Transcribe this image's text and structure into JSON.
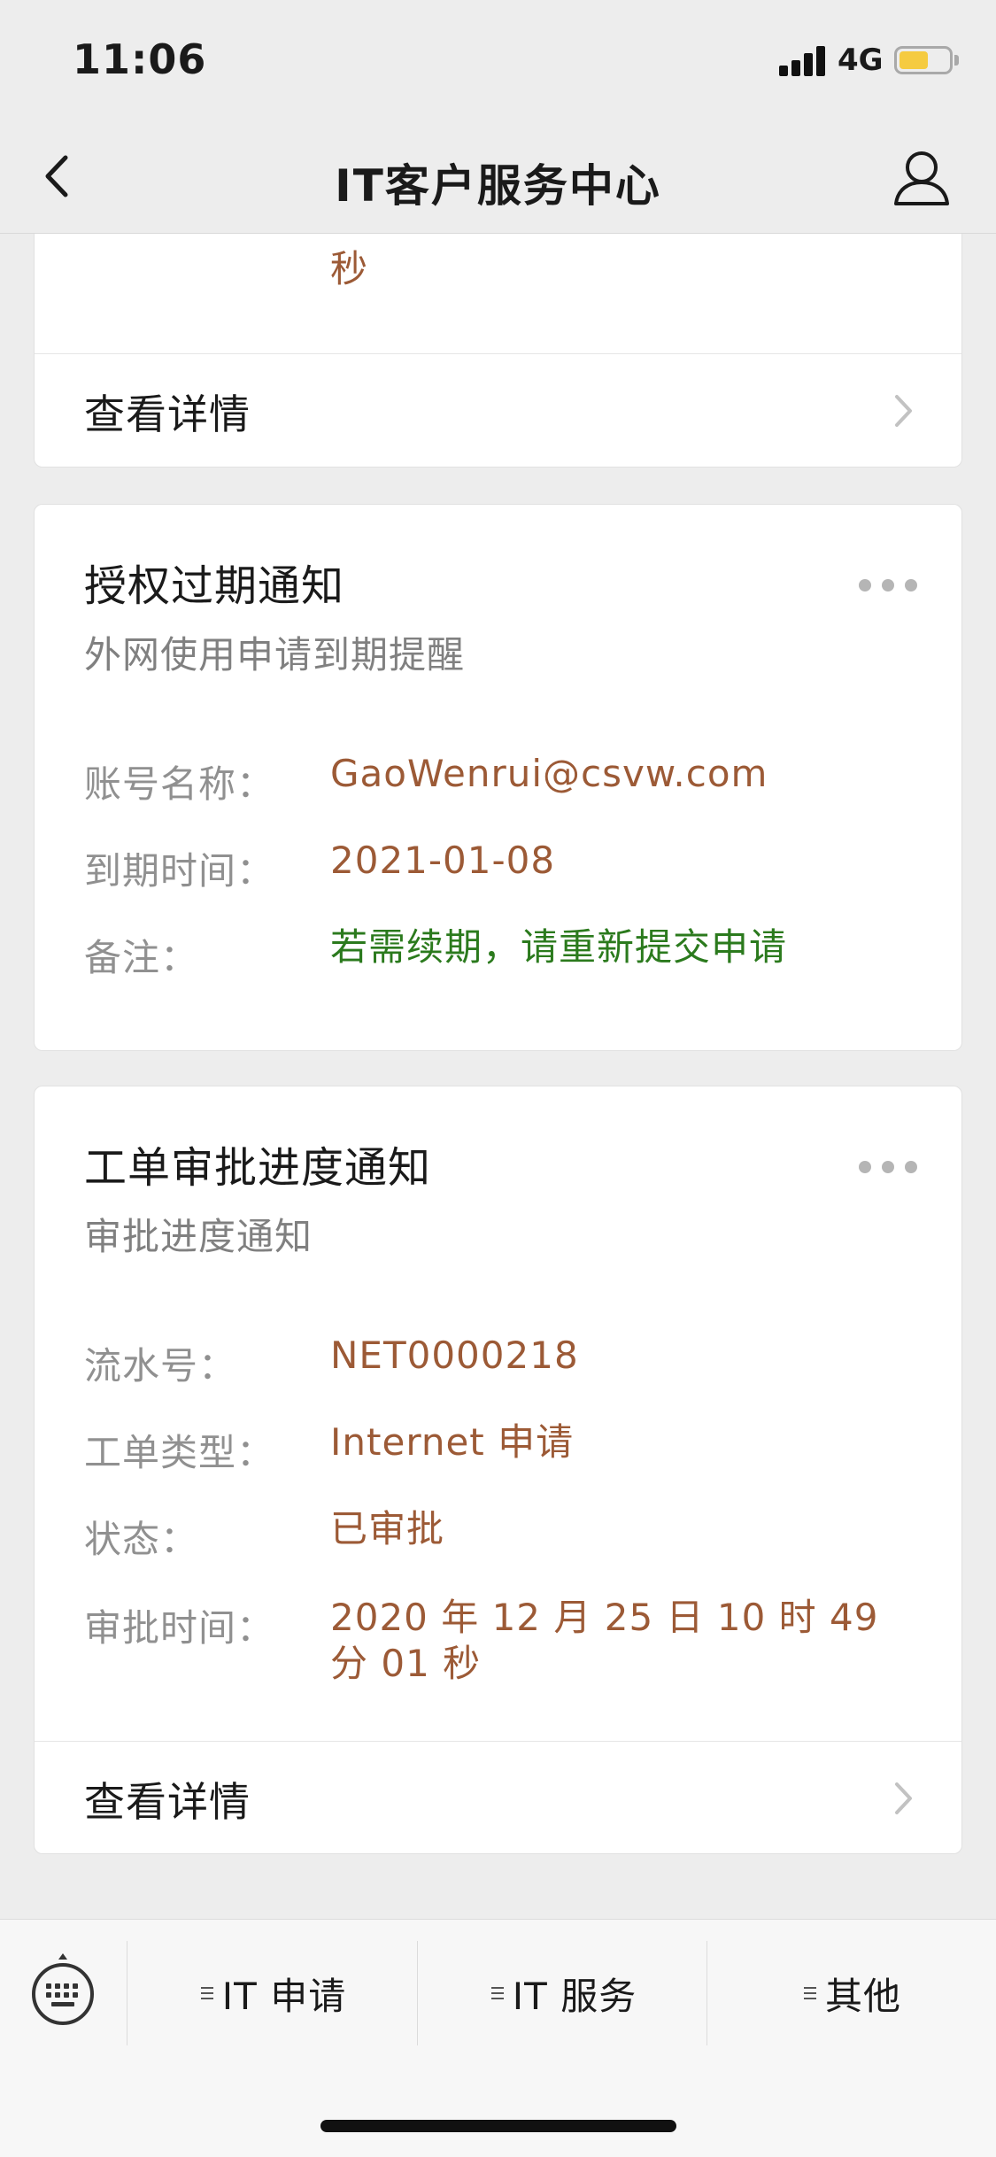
{
  "status_bar": {
    "time": "11:06",
    "network": "4G",
    "battery_level_fraction": 0.6
  },
  "nav": {
    "title": "IT客户服务中心",
    "back_icon": "chevron-left-icon",
    "profile_icon": "person-icon"
  },
  "cards": [
    {
      "partial_value_tail": "秒",
      "detail_label": "查看详情"
    },
    {
      "title": "授权过期通知",
      "subtitle": "外网使用申请到期提醒",
      "fields": [
        {
          "label": "账号名称：",
          "value": "GaoWenrui@csvw.com"
        },
        {
          "label": "到期时间：",
          "value": "2021-01-08"
        },
        {
          "label": "备注：",
          "value": "若需续期，请重新提交申请"
        }
      ]
    },
    {
      "title": "工单审批进度通知",
      "subtitle": "审批进度通知",
      "fields": [
        {
          "label": "流水号：",
          "value": "NET0000218"
        },
        {
          "label": "工单类型：",
          "value": "Internet 申请"
        },
        {
          "label": "状态：",
          "value": "已审批"
        },
        {
          "label": "审批时间：",
          "value": "2020 年 12 月 25 日 10 时 49 分 01 秒"
        }
      ],
      "detail_label": "查看详情"
    }
  ],
  "bottom_menu": {
    "keyboard_icon": "keyboard-icon",
    "items": [
      "IT 申请",
      "IT 服务",
      "其他"
    ]
  },
  "colors": {
    "value_brown": "#9c5a36",
    "value_green": "#2b7a1d",
    "background": "#ededed"
  }
}
